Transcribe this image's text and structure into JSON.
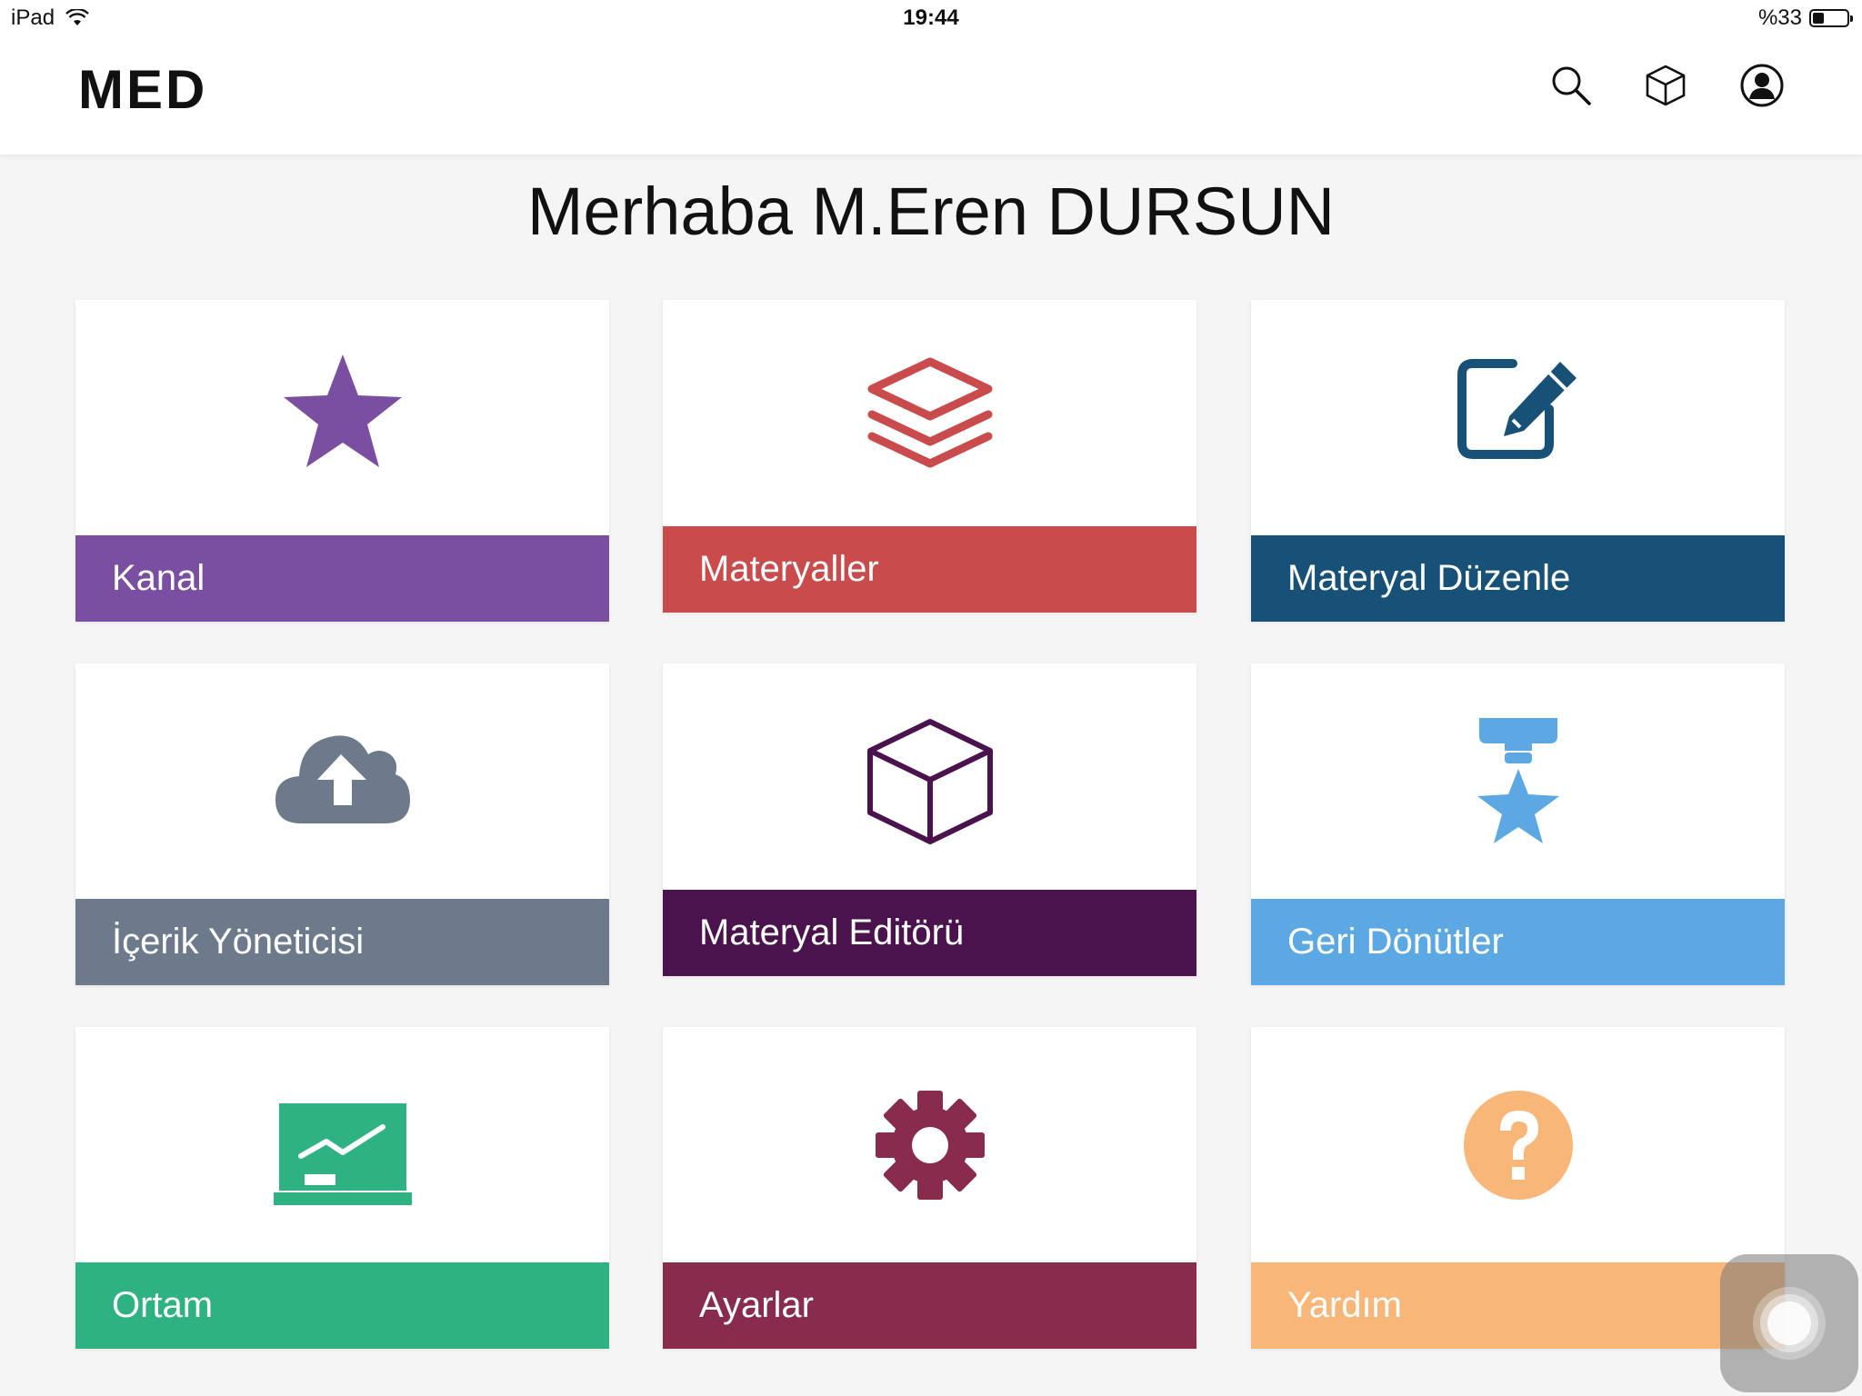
{
  "status_bar": {
    "device": "iPad",
    "time": "19:44",
    "battery_text": "%33",
    "battery_level": 0.33
  },
  "header": {
    "logo": "MED",
    "icons": [
      "search-icon",
      "cube-icon",
      "user-icon"
    ]
  },
  "greeting": "Merhaba M.Eren DURSUN",
  "tiles": [
    {
      "label": "Kanal",
      "icon": "star-icon",
      "color": "#7a4ea0"
    },
    {
      "label": "Materyaller",
      "icon": "layers-icon",
      "color": "#c94b4b"
    },
    {
      "label": "Materyal Düzenle",
      "icon": "edit-icon",
      "color": "#175177"
    },
    {
      "label": "İçerik Yöneticisi",
      "icon": "cloud-upload-icon",
      "color": "#6d7a8b"
    },
    {
      "label": "Materyal Editörü",
      "icon": "cube-icon",
      "color": "#4a134d"
    },
    {
      "label": "Geri Dönütler",
      "icon": "medal-icon",
      "color": "#5ca8e3"
    },
    {
      "label": "Ortam",
      "icon": "presentation-chart-icon",
      "color": "#2fb282"
    },
    {
      "label": "Ayarlar",
      "icon": "gear-icon",
      "color": "#882b4d"
    },
    {
      "label": "Yardım",
      "icon": "question-icon",
      "color": "#f8b679"
    }
  ]
}
